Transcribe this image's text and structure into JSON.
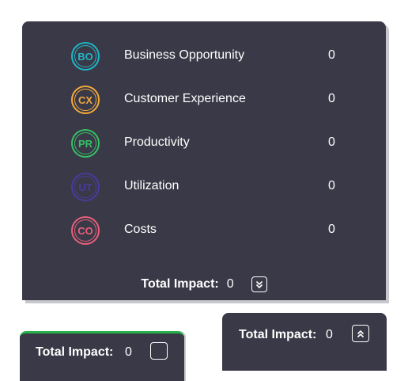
{
  "panel": {
    "items": [
      {
        "abbr": "BO",
        "label": "Business Opportunity",
        "value": "0",
        "color": "#1fb6c7"
      },
      {
        "abbr": "CX",
        "label": "Customer Experience",
        "value": "0",
        "color": "#f2a93b"
      },
      {
        "abbr": "PR",
        "label": "Productivity",
        "value": "0",
        "color": "#35c065"
      },
      {
        "abbr": "UT",
        "label": "Utilization",
        "value": "0",
        "color": "#4a3a9e"
      },
      {
        "abbr": "CO",
        "label": "Costs",
        "value": "0",
        "color": "#e8607a"
      }
    ],
    "total_label": "Total Impact:",
    "total_value": "0",
    "toggle_icon": "chevrons-down-icon"
  },
  "card_right": {
    "total_label": "Total Impact:",
    "total_value": "0",
    "toggle_icon": "chevrons-up-icon"
  },
  "card_left": {
    "total_label": "Total Impact:",
    "total_value": "0",
    "accent_color": "#27b34a"
  }
}
